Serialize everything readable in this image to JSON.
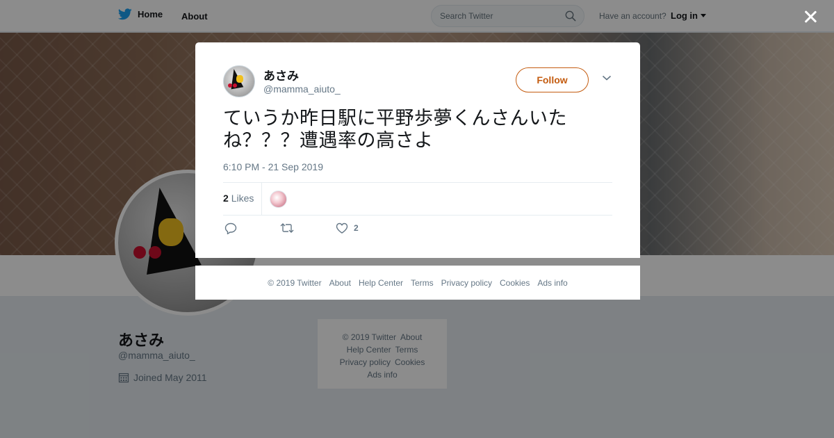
{
  "topbar": {
    "home_label": "Home",
    "about_label": "About",
    "search_placeholder": "Search Twitter",
    "account_prompt": "Have an account?",
    "login_label": "Log in"
  },
  "profile": {
    "name": "あさみ",
    "handle": "@mamma_aiuto_",
    "joined": "Joined May 2011"
  },
  "side_footer": {
    "row1": [
      "© 2019 Twitter",
      "About"
    ],
    "row2": [
      "Help Center",
      "Terms"
    ],
    "row3": [
      "Privacy policy",
      "Cookies"
    ],
    "row4": [
      "Ads info"
    ]
  },
  "tweet": {
    "author_name": "あさみ",
    "author_handle": "@mamma_aiuto_",
    "follow_label": "Follow",
    "text_line1": "ていうか昨日駅に平野歩夢くんさんいた",
    "text_line2": "ね？？？遭遇率の高さよ",
    "timestamp": "6:10 PM - 21 Sep 2019",
    "likes_count": "2",
    "likes_label": "Likes",
    "action_like_count": "2"
  },
  "modal_footer": {
    "links": [
      "© 2019 Twitter",
      "About",
      "Help Center",
      "Terms",
      "Privacy policy",
      "Cookies",
      "Ads info"
    ]
  },
  "colors": {
    "accent": "#c45c10",
    "brand_bird": "#1da1f2",
    "muted_text": "#657786"
  },
  "icons": [
    "twitter-bird-icon",
    "search-icon",
    "close-icon",
    "chevron-down-icon",
    "reply-icon",
    "retweet-icon",
    "heart-icon",
    "calendar-icon"
  ]
}
